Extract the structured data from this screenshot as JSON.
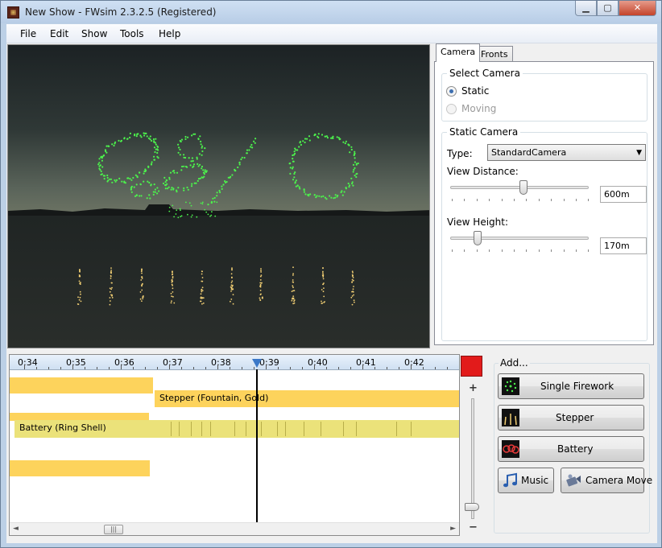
{
  "window": {
    "title": "New Show - FWsim 2.3.2.5 (Registered)",
    "min": "▁",
    "max": "▢",
    "close": "✕"
  },
  "menu": [
    "File",
    "Edit",
    "Show",
    "Tools",
    "Help"
  ],
  "tabs": {
    "camera": "Camera",
    "fronts": "Fronts"
  },
  "select_camera": {
    "title": "Select Camera",
    "static": "Static",
    "moving": "Moving",
    "selected": "Static"
  },
  "static_camera": {
    "title": "Static Camera",
    "type_label": "Type:",
    "type_value": "StandardCamera",
    "distance_label": "View Distance:",
    "distance_value": "600m",
    "distance_level": 0.54,
    "height_label": "View Height:",
    "height_value": "170m",
    "height_level": 0.18
  },
  "timeline": {
    "ticks": [
      "0:34",
      "0:35",
      "0:36",
      "0:37",
      "0:38",
      "0:39",
      "0:40",
      "0:41",
      "0:42"
    ],
    "tracks": {
      "stepper": "Stepper (Fountain, Gold)",
      "battery": "Battery (Ring Shell)"
    },
    "zoom_plus": "+",
    "zoom_minus": "−",
    "scroll_left": "◄",
    "scroll_right": "►",
    "scroll_grip": "|||"
  },
  "add": {
    "title": "Add...",
    "single": "Single Firework",
    "stepper": "Stepper",
    "battery": "Battery",
    "music": "Music",
    "camera_move": "Camera Move"
  },
  "colors": {
    "accent_stop": "#e21b1b",
    "track_orange": "#fdd35c",
    "track_green": "#ebe27a",
    "firework_green": "#4cf24c",
    "fountain_gold": "#f3d074"
  }
}
